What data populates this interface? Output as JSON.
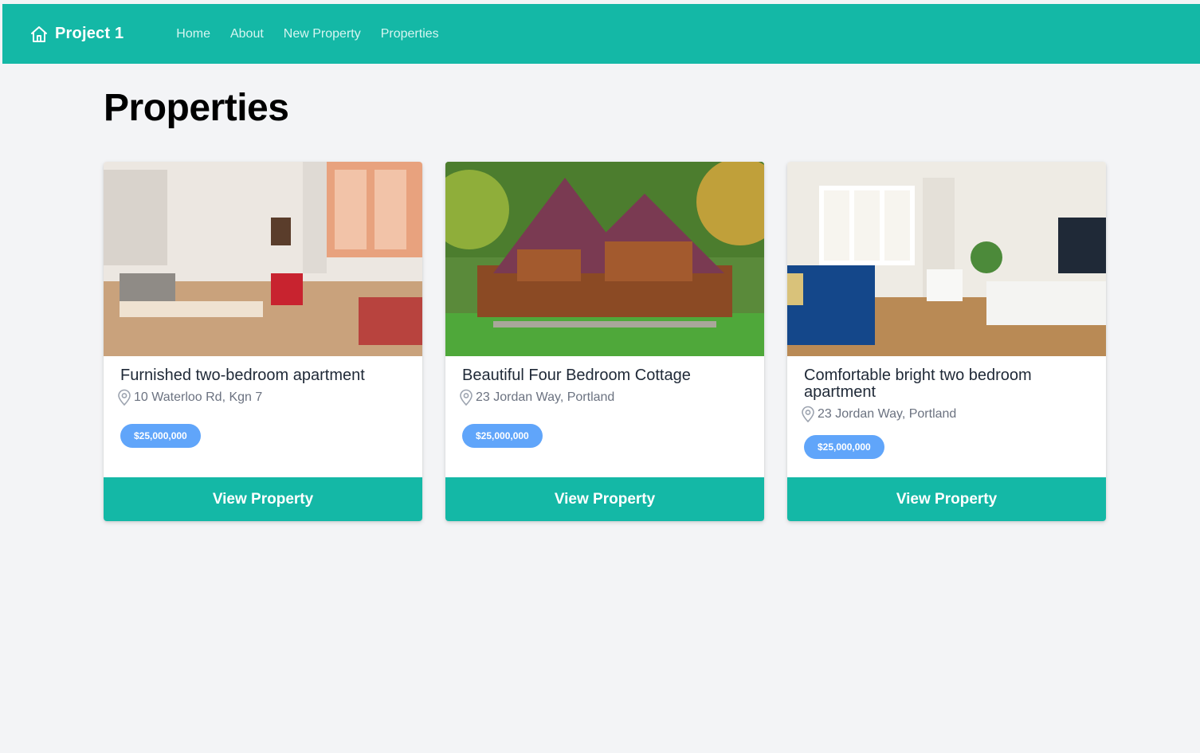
{
  "navbar": {
    "brand": "Project 1",
    "brand_icon": "home-icon",
    "links": [
      "Home",
      "About",
      "New Property",
      "Properties"
    ],
    "colors": {
      "primary": "#14b8a6",
      "badge": "#60a5fa",
      "background": "#f3f4f6"
    }
  },
  "page": {
    "title": "Properties"
  },
  "cards": [
    {
      "title": "Furnished two-bedroom apartment",
      "address": "10 Waterloo Rd, Kgn 7",
      "price": "$25,000,000",
      "button": "View Property"
    },
    {
      "title": "Beautiful Four Bedroom Cottage",
      "address": "23 Jordan Way, Portland",
      "price": "$25,000,000",
      "button": "View Property"
    },
    {
      "title": "Comfortable bright two bedroom apartment",
      "address": "23 Jordan Way, Portland",
      "price": "$25,000,000",
      "button": "View Property"
    }
  ]
}
